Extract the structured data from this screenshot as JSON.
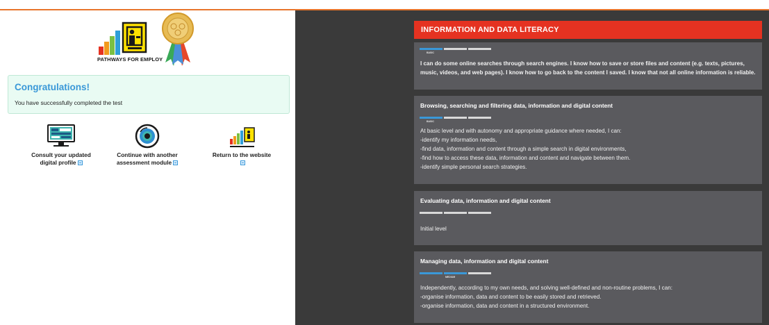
{
  "brand": {
    "name": "PATHWAYS FOR EMPLOY",
    "small_name": "PATHWAYS FOR EMPLOY"
  },
  "congrats": {
    "title": "Congratulations!",
    "message": "You have successfully completed the test"
  },
  "actions": [
    {
      "line1": "Consult your updated",
      "line2": "digital profile"
    },
    {
      "line1": "Continue with another",
      "line2": "assessment module"
    },
    {
      "line1": "Return to the website",
      "line2": ""
    }
  ],
  "section": {
    "title": "INFORMATION AND DATA LITERACY",
    "level": "BASIC",
    "description": "I can do some online searches through search engines. I know how to save or store files and content (e.g. texts, pictures, music, videos, and web pages). I know how to go back to the content I saved. I know that not all online information is reliable."
  },
  "competences": [
    {
      "title": "Browsing, searching and filtering data, information and digital content",
      "level": "BASIC",
      "level_count": 1,
      "lines": [
        "At basic level and with autonomy and appropriate guidance where needed, I can:",
        "-identify my information needs,",
        "-find data, information and content through a simple search in digital environments,",
        "-find how to access these data, information and content and navigate between them.",
        "-identify simple personal search strategies."
      ]
    },
    {
      "title": "Evaluating data, information and digital content",
      "level": "",
      "level_count": 0,
      "lines": [
        "Initial level"
      ]
    },
    {
      "title": "Managing data, information and digital content",
      "level": "MEDIUM",
      "level_count": 2,
      "lines": [
        "Independently, according to my own needs, and solving well-defined and non-routine problems, I can:",
        "-organise information, data and content to be easily stored and retrieved.",
        "-organise information, data and content in a structured environment."
      ]
    }
  ],
  "colors": {
    "accent": "#3a98d8",
    "header_red": "#e53221",
    "panel_dark": "#3a3a3a",
    "card": "#5a5a5e",
    "top_line": "#e8742a"
  }
}
